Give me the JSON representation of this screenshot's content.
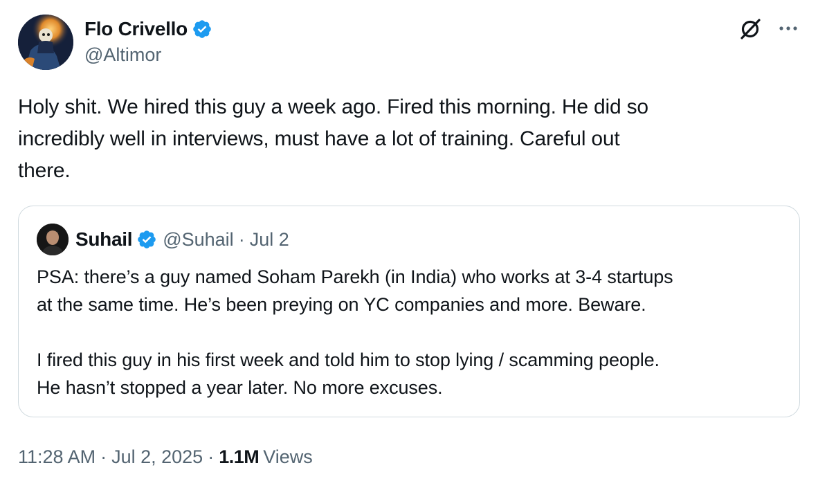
{
  "author": {
    "name": "Flo Crivello",
    "handle": "@Altimor"
  },
  "tweet": {
    "text": "Holy shit. We hired this guy a week ago. Fired this morning. He did so\nincredibly well in interviews, must have a lot of training. Careful out\nthere."
  },
  "quoted": {
    "name": "Suhail",
    "handle": "@Suhail",
    "separator": "·",
    "date": "Jul 2",
    "text": "PSA: there’s a guy named Soham Parekh (in India) who works at 3-4 startups\nat the same time. He’s been preying on YC companies and more. Beware.\n\nI fired this guy in his first week and told him to stop lying / scamming people.\nHe hasn’t stopped a year later. No more excuses."
  },
  "meta": {
    "time": "11:28 AM",
    "separator": "·",
    "date": "Jul 2, 2025",
    "views_count": "1.1M",
    "views_label": "Views"
  },
  "icons": {
    "verified": "verified-badge-icon",
    "grok": "grok-icon",
    "more": "more-icon"
  },
  "colors": {
    "verified_blue": "#1d9bf0",
    "secondary_text": "#536471",
    "primary_text": "#0f1419",
    "border": "#cfd9de"
  }
}
